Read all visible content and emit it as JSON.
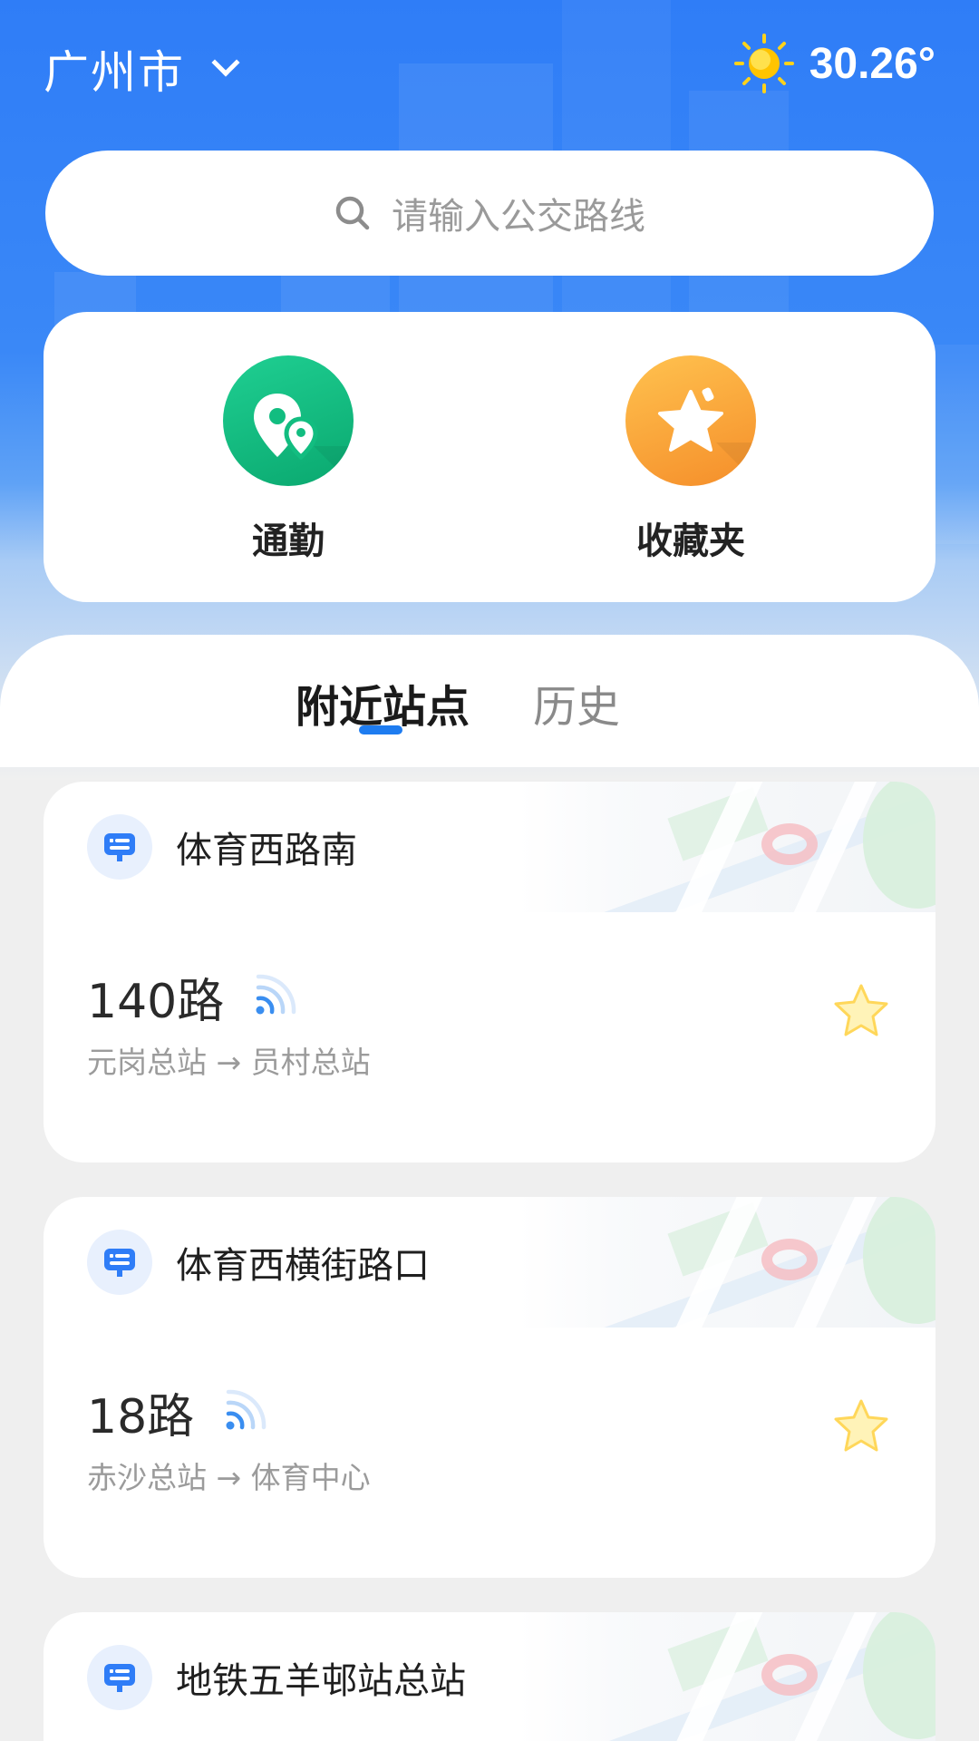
{
  "header": {
    "city": "广州市",
    "temperature": "30.26°",
    "weather_icon": "sun-icon"
  },
  "search": {
    "placeholder": "请输入公交路线"
  },
  "quick_actions": [
    {
      "label": "通勤",
      "icon": "commute-pin-icon",
      "color": "#12bd80"
    },
    {
      "label": "收藏夹",
      "icon": "star-folder-icon",
      "color": "#f9a23a"
    }
  ],
  "tabs": [
    {
      "label": "附近站点",
      "active": true
    },
    {
      "label": "历史",
      "active": false
    }
  ],
  "stops": [
    {
      "name": "体育西路南",
      "route": "140路",
      "from": "元岗总站",
      "arrow": "→",
      "to": "员村总站"
    },
    {
      "name": "体育西横街路口",
      "route": "18路",
      "from": "赤沙总站",
      "arrow": "→",
      "to": "体育中心"
    },
    {
      "name": "地铁五羊邨站总站"
    }
  ],
  "colors": {
    "primary": "#2f7df7",
    "tab_indicator": "#1e7cf0",
    "signal": "#3a8ef0",
    "favorite_star": "#ffe58a"
  }
}
